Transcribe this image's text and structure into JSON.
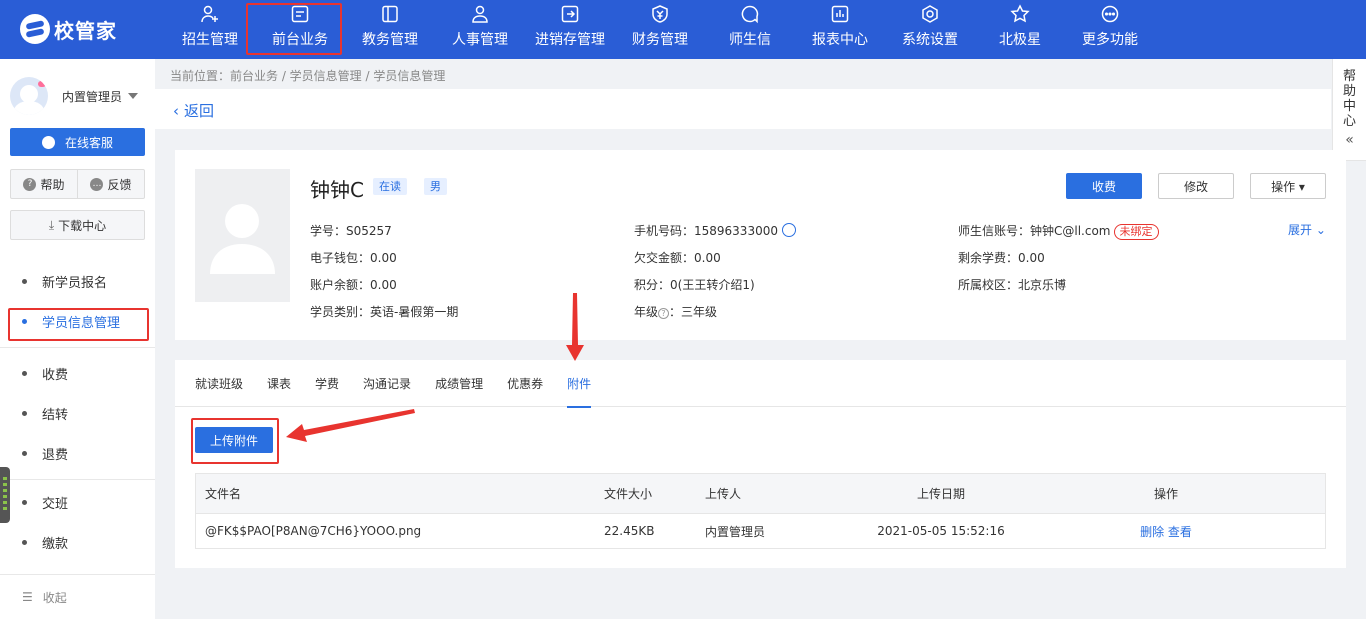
{
  "app": {
    "logo_text": "校管家"
  },
  "nav": [
    {
      "label": "招生管理",
      "icon": "user-add-icon"
    },
    {
      "label": "前台业务",
      "icon": "desk-icon"
    },
    {
      "label": "教务管理",
      "icon": "book-icon"
    },
    {
      "label": "人事管理",
      "icon": "person-icon"
    },
    {
      "label": "进销存管理",
      "icon": "inventory-icon"
    },
    {
      "label": "财务管理",
      "icon": "yen-shield-icon"
    },
    {
      "label": "师生信",
      "icon": "chat-icon"
    },
    {
      "label": "报表中心",
      "icon": "report-icon"
    },
    {
      "label": "系统设置",
      "icon": "gear-icon"
    },
    {
      "label": "北极星",
      "icon": "star-icon"
    },
    {
      "label": "更多功能",
      "icon": "more-icon"
    }
  ],
  "sidebar": {
    "user_name": "内置管理员",
    "service_label": "在线客服",
    "help_label": "帮助",
    "feedback_label": "反馈",
    "download_label": "下载中心",
    "items": [
      {
        "label": "新学员报名"
      },
      {
        "label": "学员信息管理"
      },
      {
        "label": "收费"
      },
      {
        "label": "结转"
      },
      {
        "label": "退费"
      },
      {
        "label": "交班"
      },
      {
        "label": "缴款"
      }
    ],
    "collapse_label": "收起"
  },
  "breadcrumb": "当前位置：前台业务 / 学员信息管理 / 学员信息管理",
  "back_label": "返回",
  "help_center": [
    "帮",
    "助",
    "中",
    "心"
  ],
  "student": {
    "name": "钟钟C",
    "status_tag": "在读",
    "gender_tag": "男",
    "fields": {
      "student_no": "学号：S05257",
      "phone": "手机号码：15896333000",
      "account": "师生信账号：钟钟C@ll.com",
      "unbound": "未绑定",
      "wallet": "电子钱包：0.00",
      "owed": "欠交金额：0.00",
      "remaining_fee": "剩余学费：0.00",
      "balance": "账户余额：0.00",
      "points": "积分：0(王王转介绍1)",
      "campus": "所属校区：北京乐博",
      "category": "学员类别：英语-暑假第一期",
      "grade_label": "年级",
      "grade_value": "：三年级"
    },
    "actions": {
      "charge": "收费",
      "edit": "修改",
      "operate": "操作 ▾",
      "expand": "展开 ⌄"
    }
  },
  "tabs": [
    {
      "label": "就读班级"
    },
    {
      "label": "课表"
    },
    {
      "label": "学费"
    },
    {
      "label": "沟通记录"
    },
    {
      "label": "成绩管理"
    },
    {
      "label": "优惠券"
    },
    {
      "label": "附件"
    }
  ],
  "upload_label": "上传附件",
  "table": {
    "headers": [
      "文件名",
      "文件大小",
      "上传人",
      "上传日期",
      "操作"
    ],
    "rows": [
      {
        "name": "@FK$$PAO[P8AN@7CH6}YOOO.png",
        "size": "22.45KB",
        "uploader": "内置管理员",
        "date": "2021-05-05 15:52:16",
        "delete": "删除",
        "view": "查看"
      }
    ]
  },
  "colors": {
    "brand": "#2a5dd6",
    "primary": "#2a6fe0",
    "highlight": "#e8342f"
  }
}
